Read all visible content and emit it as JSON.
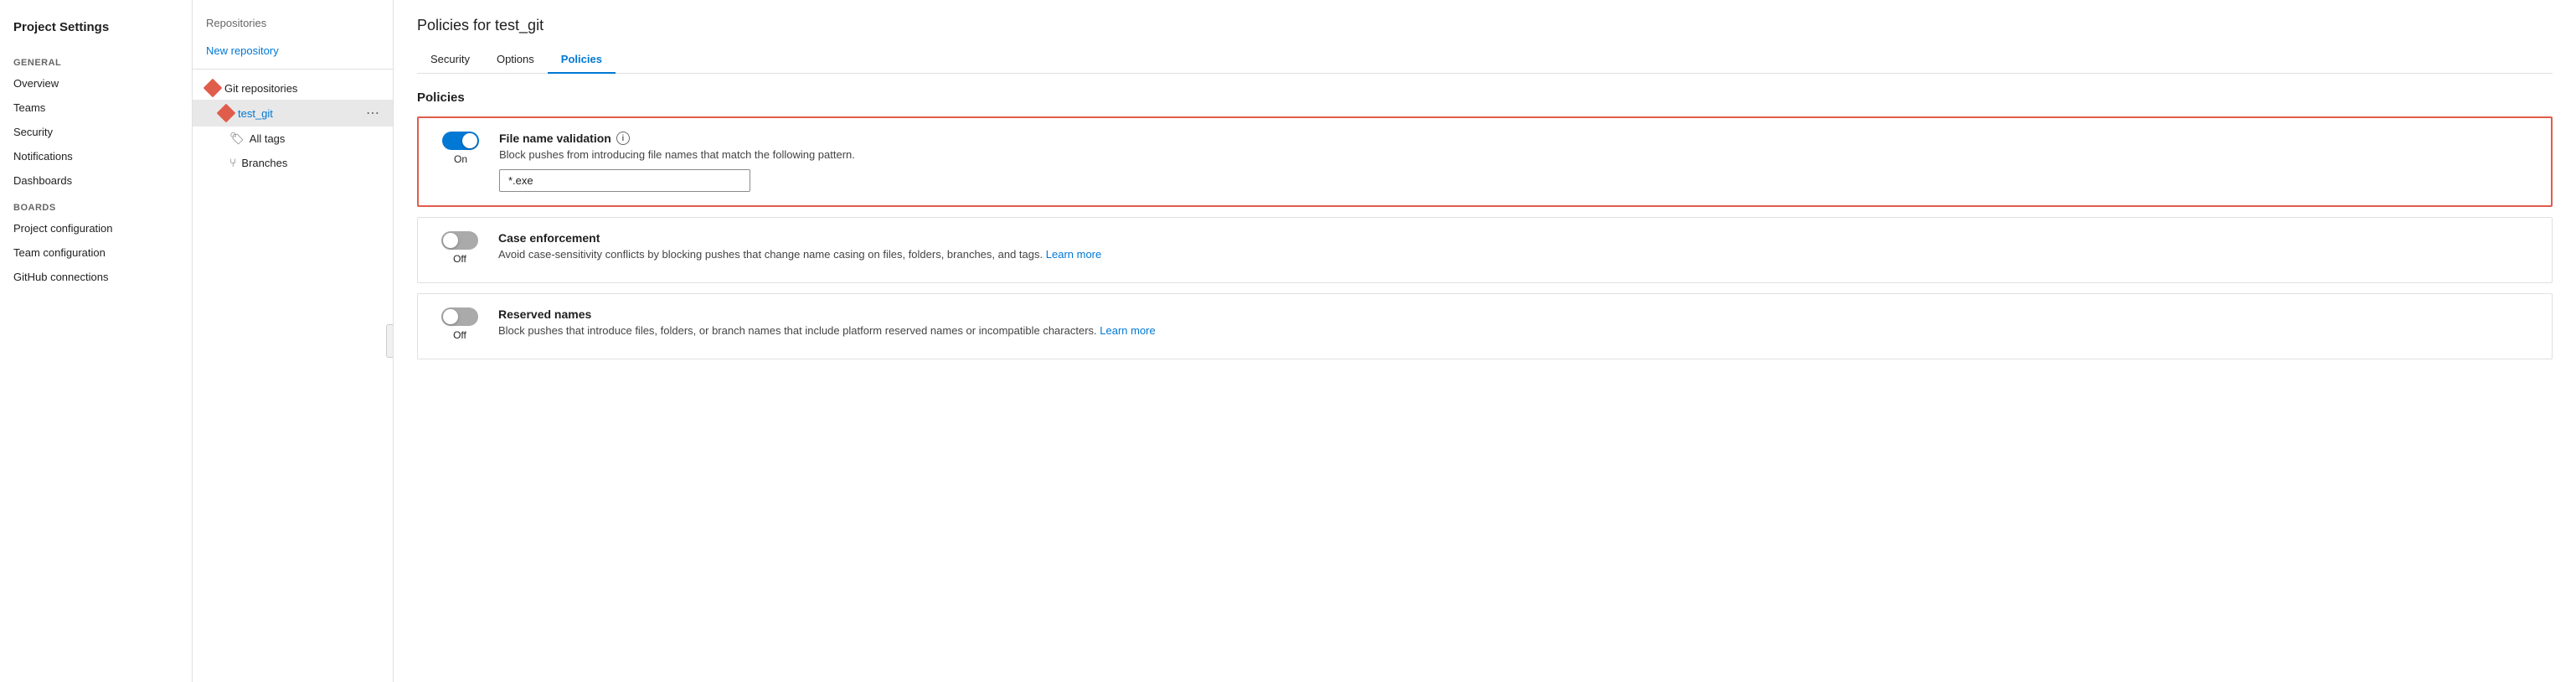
{
  "project_settings_sidebar": {
    "title": "Project Settings",
    "general_label": "General",
    "items": [
      {
        "label": "Overview",
        "name": "overview"
      },
      {
        "label": "Teams",
        "name": "teams"
      },
      {
        "label": "Security",
        "name": "security"
      },
      {
        "label": "Notifications",
        "name": "notifications"
      },
      {
        "label": "Dashboards",
        "name": "dashboards"
      }
    ],
    "boards_label": "Boards",
    "boards_items": [
      {
        "label": "Project configuration",
        "name": "project-configuration"
      },
      {
        "label": "Team configuration",
        "name": "team-configuration"
      },
      {
        "label": "GitHub connections",
        "name": "github-connections"
      }
    ]
  },
  "repo_sidebar": {
    "title": "Repositories",
    "new_repo_label": "New repository",
    "git_repos_label": "Git repositories",
    "selected_repo": "test_git",
    "sub_items": [
      {
        "label": "All tags",
        "icon": "🏷"
      },
      {
        "label": "Branches",
        "icon": "⑂"
      }
    ]
  },
  "main": {
    "page_title": "Policies for test_git",
    "tabs": [
      {
        "label": "Security",
        "active": false
      },
      {
        "label": "Options",
        "active": false
      },
      {
        "label": "Policies",
        "active": true
      }
    ],
    "policies_section": {
      "title": "Policies",
      "items": [
        {
          "name": "file-name-validation",
          "toggle_state": "On",
          "toggle_on": true,
          "highlighted": true,
          "policy_name": "File name validation",
          "has_info": true,
          "description": "Block pushes from introducing file names that match the following pattern.",
          "input_value": "*.exe",
          "learn_more": null
        },
        {
          "name": "case-enforcement",
          "toggle_state": "Off",
          "toggle_on": false,
          "highlighted": false,
          "policy_name": "Case enforcement",
          "has_info": false,
          "description": "Avoid case-sensitivity conflicts by blocking pushes that change name casing on files, folders, branches, and tags.",
          "input_value": null,
          "learn_more": "Learn more"
        },
        {
          "name": "reserved-names",
          "toggle_state": "Off",
          "toggle_on": false,
          "highlighted": false,
          "policy_name": "Reserved names",
          "has_info": false,
          "description": "Block pushes that introduce files, folders, or branch names that include platform reserved names or incompatible characters.",
          "input_value": null,
          "learn_more": "Learn more"
        }
      ]
    }
  }
}
